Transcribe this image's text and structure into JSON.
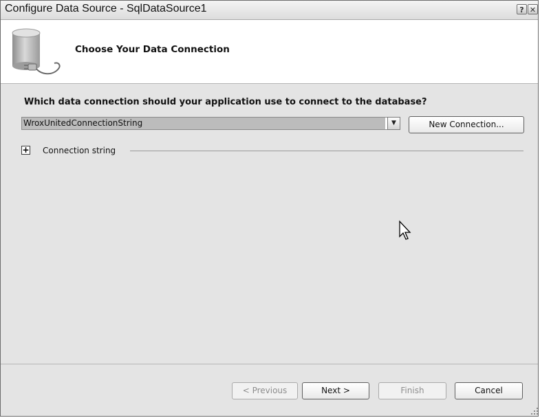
{
  "window": {
    "title": "Configure Data Source - SqlDataSource1",
    "help_glyph": "?",
    "close_glyph": "✕"
  },
  "header": {
    "title": "Choose Your Data Connection"
  },
  "main": {
    "question": "Which data connection should your application use to connect to the database?",
    "connection_select": {
      "value": "WroxUnitedConnectionString"
    },
    "new_connection_label": "New Connection...",
    "connection_string": {
      "expander_glyph": "+",
      "label": "Connection string"
    }
  },
  "footer": {
    "previous_label": "< Previous",
    "next_label": "Next >",
    "finish_label": "Finish",
    "cancel_label": "Cancel"
  }
}
